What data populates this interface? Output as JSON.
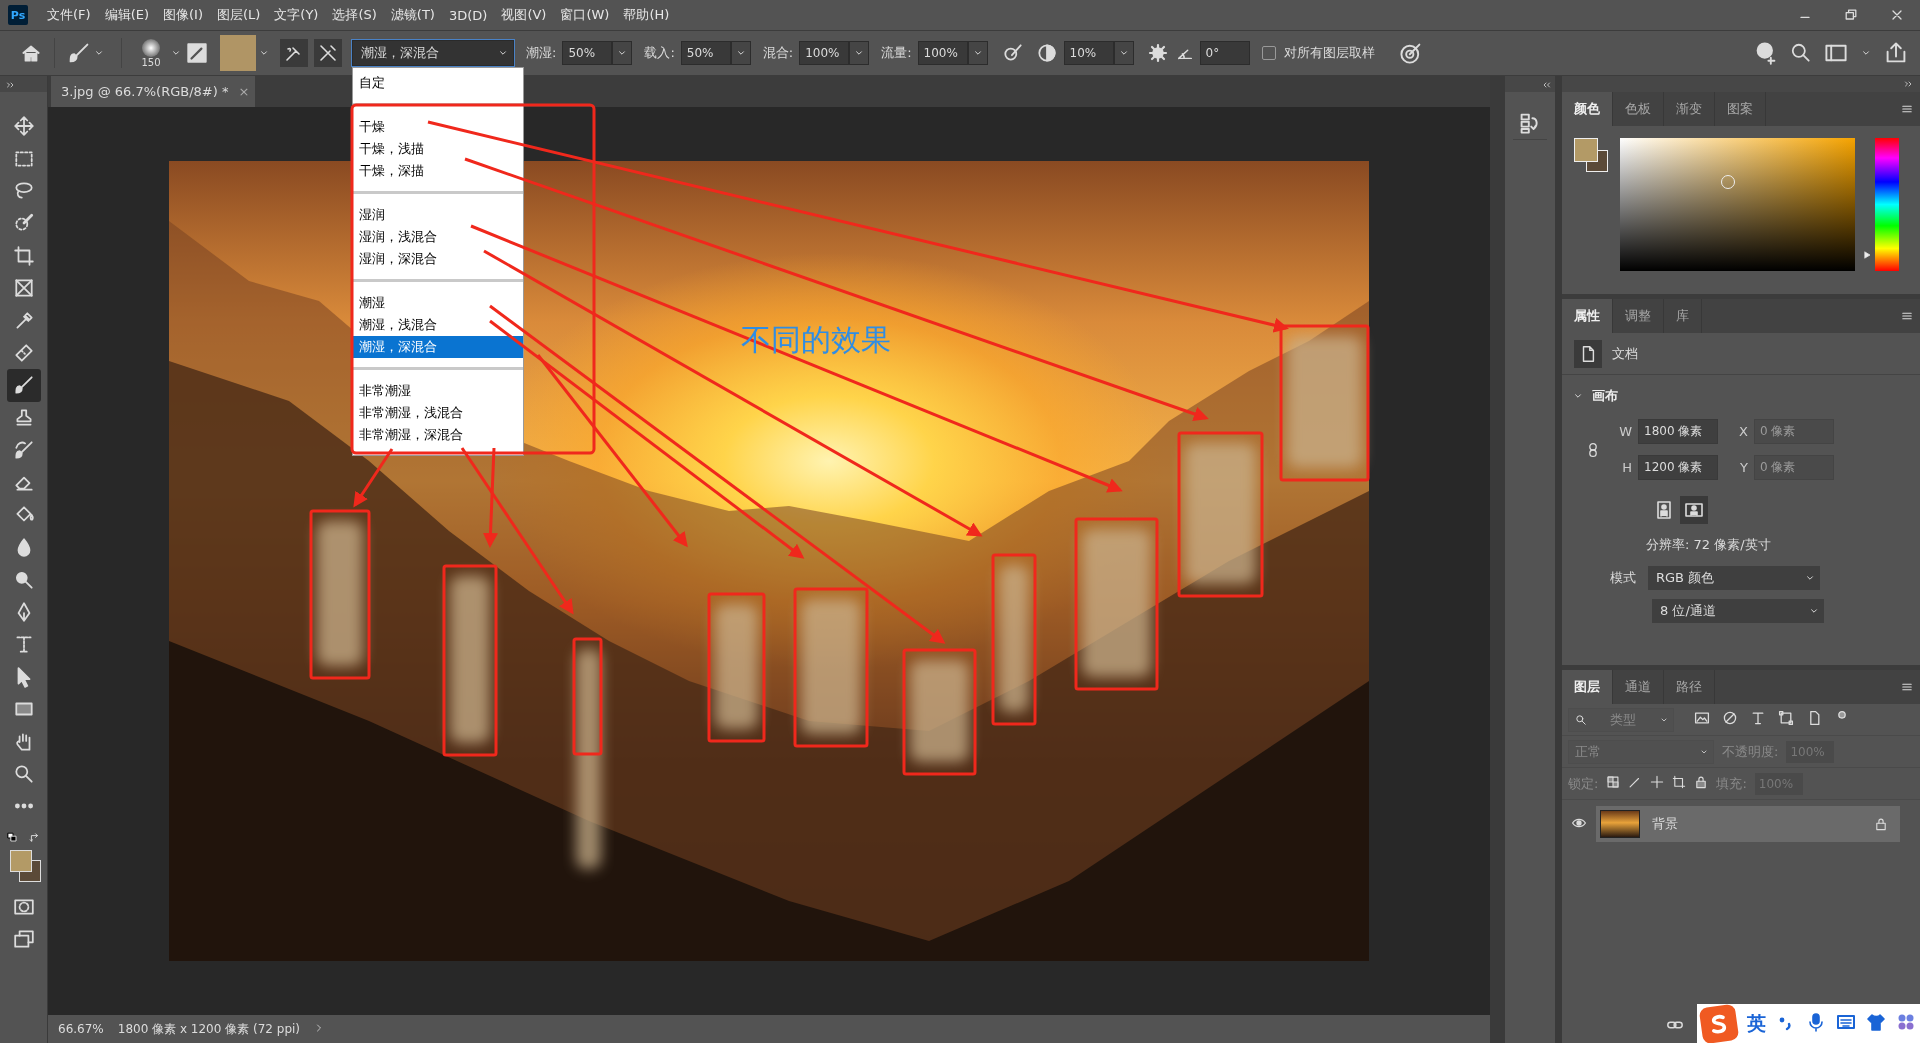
{
  "app_logo": "Ps",
  "menu": [
    "文件(F)",
    "编辑(E)",
    "图像(I)",
    "图层(L)",
    "文字(Y)",
    "选择(S)",
    "滤镜(T)",
    "3D(D)",
    "视图(V)",
    "窗口(W)",
    "帮助(H)"
  ],
  "options_bar": {
    "brush_size": "150",
    "preset": {
      "value": "潮湿，深混合",
      "expanded": true,
      "groups": [
        {
          "items": [
            {
              "label": "自定",
              "selected": false
            }
          ]
        },
        {
          "items": [
            {
              "label": "干燥",
              "selected": false
            },
            {
              "label": "干燥，浅描",
              "selected": false
            },
            {
              "label": "干燥，深描",
              "selected": false
            }
          ]
        },
        {
          "items": [
            {
              "label": "湿润",
              "selected": false
            },
            {
              "label": "湿润，浅混合",
              "selected": false
            },
            {
              "label": "湿润，深混合",
              "selected": false
            }
          ]
        },
        {
          "items": [
            {
              "label": "潮湿",
              "selected": false
            },
            {
              "label": "潮湿，浅混合",
              "selected": false
            },
            {
              "label": "潮湿，深混合",
              "selected": true
            }
          ]
        },
        {
          "items": [
            {
              "label": "非常潮湿",
              "selected": false
            },
            {
              "label": "非常潮湿，浅混合",
              "selected": false
            },
            {
              "label": "非常潮湿，深混合",
              "selected": false
            }
          ]
        }
      ]
    },
    "fields": [
      {
        "label": "潮湿:",
        "value": "50%"
      },
      {
        "label": "载入:",
        "value": "50%"
      },
      {
        "label": "混合:",
        "value": "100%"
      },
      {
        "label": "流量:",
        "value": "100%"
      }
    ],
    "smoothing": "10%",
    "angle": "0°",
    "sample_all_layers": {
      "label": "对所有图层取样",
      "checked": false
    }
  },
  "tools": [
    {
      "kind": "move",
      "selected": false
    },
    {
      "kind": "marquee",
      "selected": false
    },
    {
      "kind": "lasso",
      "selected": false
    },
    {
      "kind": "quick-select",
      "selected": false
    },
    {
      "kind": "crop",
      "selected": false
    },
    {
      "kind": "frame",
      "selected": false
    },
    {
      "kind": "eyedropper",
      "selected": false
    },
    {
      "kind": "healing",
      "selected": false
    },
    {
      "kind": "brush",
      "selected": true
    },
    {
      "kind": "stamp",
      "selected": false
    },
    {
      "kind": "history-brush",
      "selected": false
    },
    {
      "kind": "eraser",
      "selected": false
    },
    {
      "kind": "bucket",
      "selected": false
    },
    {
      "kind": "blur",
      "selected": false
    },
    {
      "kind": "dodge",
      "selected": false
    },
    {
      "kind": "pen",
      "selected": false
    },
    {
      "kind": "type",
      "selected": false
    },
    {
      "kind": "path-select",
      "selected": false
    },
    {
      "kind": "rectangle",
      "selected": false
    },
    {
      "kind": "hand",
      "selected": false
    },
    {
      "kind": "zoom",
      "selected": false
    },
    {
      "kind": "more",
      "selected": false
    }
  ],
  "document_tab": {
    "title": "3.jpg @ 66.7%(RGB/8#) *",
    "close": "×"
  },
  "annotation": {
    "label": "不同的效果"
  },
  "status_bar": {
    "zoom": "66.67%",
    "info": "1800 像素 x 1200 像素 (72 ppi)"
  },
  "color_panel": {
    "hue_slider": {
      "level": 0.12
    },
    "tabs": [
      {
        "label": "颜色",
        "selected": true
      },
      {
        "label": "色板",
        "selected": false
      },
      {
        "label": "渐变",
        "selected": false
      },
      {
        "label": "图案",
        "selected": false
      }
    ]
  },
  "properties_panel": {
    "tabs": [
      {
        "label": "属性",
        "selected": true
      },
      {
        "label": "调整",
        "selected": false
      },
      {
        "label": "库",
        "selected": false
      }
    ],
    "type": "文档",
    "section": {
      "title": "画布",
      "expanded": true
    },
    "dims": [
      {
        "label": "W",
        "value": "1800 像素",
        "disabled": false
      },
      {
        "label": "X",
        "value": "0 像素",
        "disabled": true
      },
      {
        "label": "H",
        "value": "1200 像素",
        "disabled": false
      },
      {
        "label": "Y",
        "value": "0 像素",
        "disabled": true
      }
    ],
    "resolution": "分辨率: 72 像素/英寸",
    "mode_label": "模式",
    "mode": "RGB 颜色",
    "depth": "8 位/通道"
  },
  "layers_panel": {
    "tabs": [
      {
        "label": "图层",
        "selected": true
      },
      {
        "label": "通道",
        "selected": false
      },
      {
        "label": "路径",
        "selected": false
      }
    ],
    "filter": "类型",
    "blend_mode": "正常",
    "opacity_label": "不透明度:",
    "opacity": "100%",
    "lock_label": "锁定:",
    "fill_label": "填充:",
    "fill": "100%",
    "layers": [
      {
        "name": "背景",
        "visible": true,
        "locked": true,
        "selected": true
      }
    ]
  },
  "ime": {
    "mode": "英"
  }
}
